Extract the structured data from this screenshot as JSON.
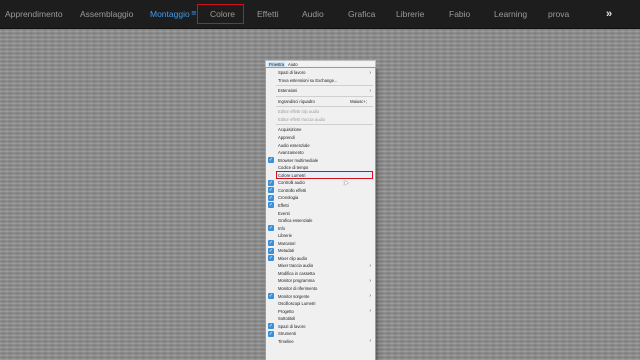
{
  "workspace_tabs": [
    {
      "label": "Apprendimento",
      "active": false
    },
    {
      "label": "Assemblaggio",
      "active": false
    },
    {
      "label": "Montaggio",
      "active": true
    },
    {
      "label": "Colore",
      "active": false,
      "highlighted": true
    },
    {
      "label": "Effetti",
      "active": false
    },
    {
      "label": "Audio",
      "active": false
    },
    {
      "label": "Grafica",
      "active": false
    },
    {
      "label": "Librerie",
      "active": false
    },
    {
      "label": "Fabio",
      "active": false
    },
    {
      "label": "Learning",
      "active": false
    },
    {
      "label": "prova",
      "active": false
    }
  ],
  "overflow_label": "»",
  "menubar": {
    "items": [
      "Finestra",
      "Aiuto"
    ]
  },
  "window_menu": {
    "items": [
      {
        "label": "Spazi di lavoro",
        "submenu": true
      },
      {
        "label": "Trova estensioni su Exchange..."
      },
      {
        "sep": true
      },
      {
        "label": "Estensioni",
        "submenu": true
      },
      {
        "sep": true
      },
      {
        "label": "Ingrandisci riquadro",
        "shortcut": "Maiusc+;"
      },
      {
        "sep": true
      },
      {
        "label": "Editor effetti clip audio",
        "disabled": true
      },
      {
        "label": "Editor effetti traccia audio",
        "disabled": true
      },
      {
        "sep": true
      },
      {
        "label": "Acquisizione"
      },
      {
        "label": "Apprendi"
      },
      {
        "label": "Audio essenziale"
      },
      {
        "label": "Avanzamento"
      },
      {
        "label": "Browser multimediale",
        "checked": true
      },
      {
        "label": "Codice di tempo"
      },
      {
        "label": "Colore Lumetri",
        "boxed": true
      },
      {
        "label": "Controlli audio",
        "checked": true
      },
      {
        "label": "Controllo effetti",
        "checked": true
      },
      {
        "label": "Cronologia",
        "checked": true
      },
      {
        "label": "Effetti",
        "checked": true
      },
      {
        "label": "Eventi"
      },
      {
        "label": "Grafica essenziale"
      },
      {
        "label": "Info",
        "checked": true
      },
      {
        "label": "Librerie"
      },
      {
        "label": "Marcatori",
        "checked": true
      },
      {
        "label": "Metadati",
        "checked": true
      },
      {
        "label": "Mixer clip audio",
        "checked": true
      },
      {
        "label": "Mixer traccia audio",
        "submenu": true
      },
      {
        "label": "Modifica in cassetta"
      },
      {
        "label": "Monitor programma",
        "submenu": true
      },
      {
        "label": "Monitor di riferimento"
      },
      {
        "label": "Monitor sorgente",
        "checked": true,
        "submenu": true
      },
      {
        "label": "Oscilloscopi Lumetri"
      },
      {
        "label": "Progetto",
        "submenu": true
      },
      {
        "label": "Sottotitoli"
      },
      {
        "label": "Spazi di lavoro",
        "checked": true
      },
      {
        "label": "Strumenti",
        "checked": true
      },
      {
        "label": "Timeline",
        "submenu": true
      }
    ]
  },
  "colors": {
    "accent": "#3d9df0",
    "highlight_box": "#d10f1f",
    "check": "#3b8ed8"
  }
}
